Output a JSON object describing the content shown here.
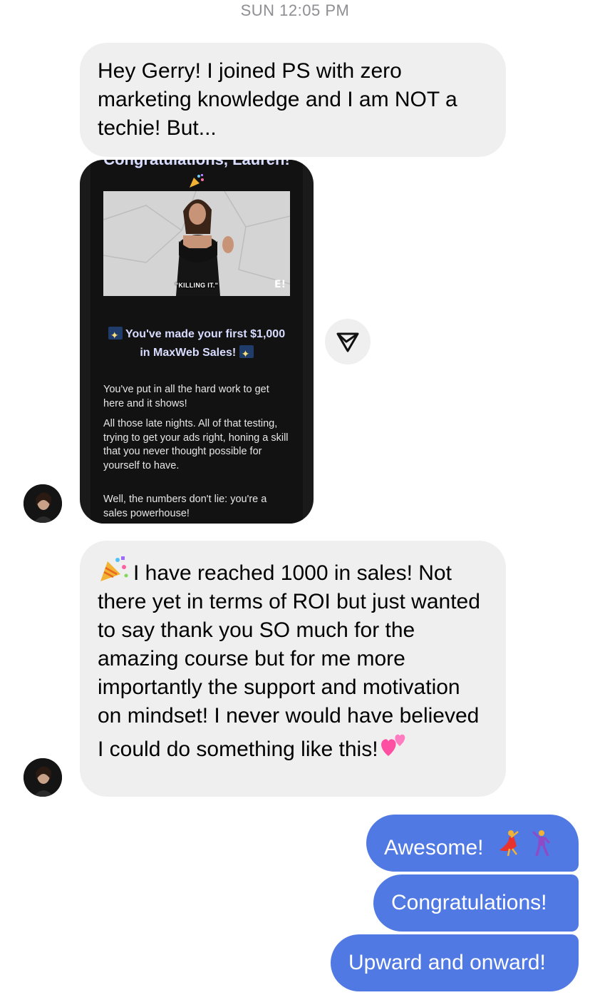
{
  "timestamp": "SUN 12:05 PM",
  "messages": {
    "incoming_1": "Hey Gerry! I joined PS with zero marketing knowledge and I am NOT a techie! But...",
    "card": {
      "header": "Congratulations, Lauren!",
      "gif_caption": "\"KILLING IT.\"",
      "gif_logo": "E!",
      "headline_line1": "You've made your first $1,000",
      "headline_line2": "in MaxWeb Sales!",
      "para1": "You've put in all the hard work to get here and it shows!",
      "para2": "All those late nights. All of that testing, trying to get your ads right, honing a skill that you never thought possible for yourself to have.",
      "para3": "Well, the numbers don't lie: you're a sales powerhouse!"
    },
    "incoming_2": "I have reached 1000 in sales! Not there yet in terms of ROI but just wanted to say thank you SO much for the amazing course but for me more importantly the support and motivation on mindset! I never would have believed I could do something like this!",
    "outgoing_1": "Awesome!",
    "outgoing_2": "Congratulations!",
    "outgoing_3": "Upward and onward!"
  },
  "icons": {
    "share": "paper-plane-icon",
    "party": "party-popper-icon",
    "hearts": "two-hearts-icon",
    "dancer": "woman-dancing-icon",
    "man_dancer": "man-dancing-icon",
    "sparkle": "sparkles-icon"
  },
  "colors": {
    "incoming_bubble": "#efefef",
    "outgoing_bubble": "#5179e3",
    "card_bg": "#121212",
    "card_text_accent": "#d8dcff"
  }
}
